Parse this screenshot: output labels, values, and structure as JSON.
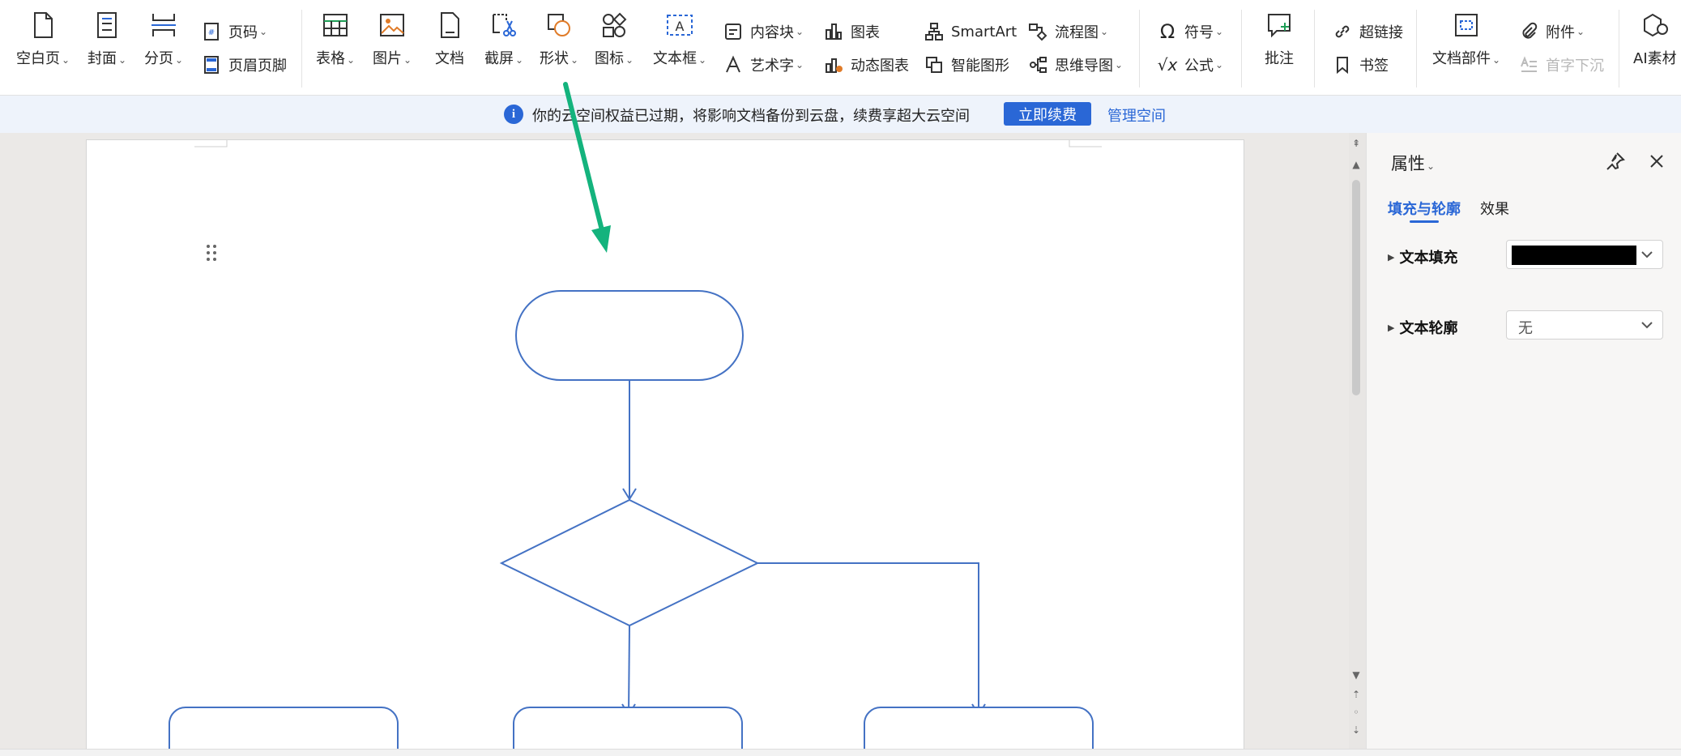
{
  "ribbon": {
    "blank_page": "空白页",
    "cover": "封面",
    "page_break": "分页",
    "page_number": "页码",
    "header_footer": "页眉页脚",
    "table": "表格",
    "picture": "图片",
    "document": "文档",
    "screenshot": "截屏",
    "shapes": "形状",
    "icons": "图标",
    "textbox": "文本框",
    "content_block": "内容块",
    "word_art": "艺术字",
    "chart": "图表",
    "dynamic_chart": "动态图表",
    "smartart": "SmartArt",
    "smart_graphic": "智能图形",
    "flowchart": "流程图",
    "mindmap": "思维导图",
    "symbol": "符号",
    "formula": "公式",
    "comment": "批注",
    "hyperlink": "超链接",
    "bookmark": "书签",
    "doc_parts": "文档部件",
    "attachment": "附件",
    "drop_cap": "首字下沉",
    "ai_material": "AI素材"
  },
  "notice": {
    "message": "你的云空间权益已过期，将影响文档备份到云盘，续费享超大云空间",
    "renew": "立即续费",
    "manage": "管理空间"
  },
  "panel": {
    "title": "属性",
    "tab_fill": "填充与轮廓",
    "tab_effect": "效果",
    "text_fill": "文本填充",
    "text_outline": "文本轮廓",
    "outline_value": "无",
    "fill_color": "#000000"
  },
  "colors": {
    "accent": "#2a67d6",
    "flow_stroke": "#4472c4",
    "arrow": "#14b37d"
  }
}
